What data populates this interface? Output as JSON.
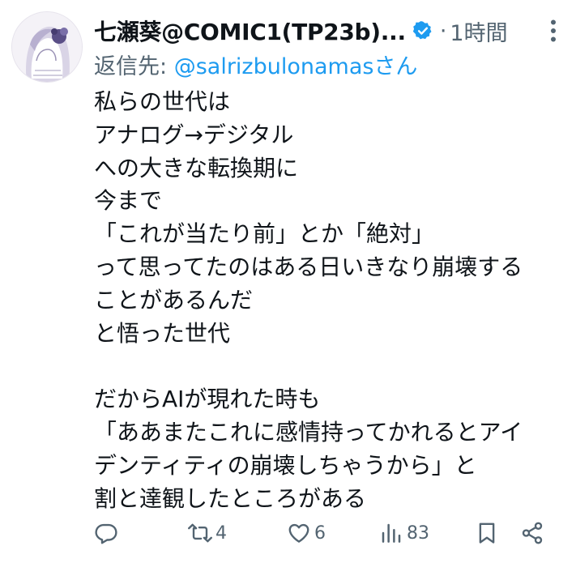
{
  "tweet": {
    "display_name": "七瀬葵@COMIC1(TP23b)...",
    "separator": "·",
    "timestamp": "1時間",
    "reply_label": "返信先:",
    "reply_handle": "@salrizbulonamasさん",
    "lines": [
      "私らの世代は",
      "アナログ→デジタル",
      "への大きな転換期に",
      "今まで",
      "「これが当たり前」とか「絶対」",
      "って思ってたのはある日いきなり崩壊する",
      "ことがあるんだ",
      "と悟った世代",
      "",
      "だからAIが現れた時も",
      "「ああまたこれに感情持ってかれるとアイ",
      "デンティティの崩壊しちゃうから」と",
      "割と達観したところがある"
    ]
  },
  "actions": {
    "reply_icon": "reply-icon",
    "retweet_count": "4",
    "like_count": "6",
    "views_count": "83",
    "bookmark_icon": "bookmark-icon",
    "share_icon": "share-icon"
  },
  "colors": {
    "text": "#0f1419",
    "secondary": "#536471",
    "link": "#1d9bf0",
    "verified": "#1d9bf0"
  }
}
